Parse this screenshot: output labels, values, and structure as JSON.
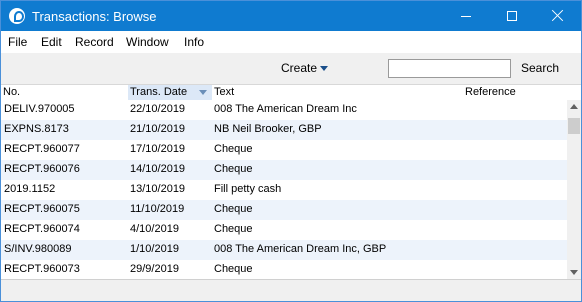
{
  "window": {
    "title": "Transactions: Browse",
    "icon": "hansaworld-icon"
  },
  "menu": [
    "File",
    "Edit",
    "Record",
    "Window",
    "Info"
  ],
  "toolbar": {
    "create_label": "Create",
    "search_value": "",
    "search_label": "Search"
  },
  "columns": {
    "no": "No.",
    "date": "Trans. Date",
    "text": "Text",
    "reference": "Reference"
  },
  "rows": [
    {
      "no": "DELIV.970005",
      "date": "22/10/2019",
      "text": "008 The American Dream Inc",
      "reference": ""
    },
    {
      "no": "EXPNS.8173",
      "date": "21/10/2019",
      "text": "NB Neil Brooker, GBP",
      "reference": ""
    },
    {
      "no": "RECPT.960077",
      "date": "17/10/2019",
      "text": "Cheque",
      "reference": ""
    },
    {
      "no": "RECPT.960076",
      "date": "14/10/2019",
      "text": "Cheque",
      "reference": ""
    },
    {
      "no": "2019.1152",
      "date": "13/10/2019",
      "text": "Fill petty cash",
      "reference": ""
    },
    {
      "no": "RECPT.960075",
      "date": "11/10/2019",
      "text": "Cheque",
      "reference": ""
    },
    {
      "no": "RECPT.960074",
      "date": "4/10/2019",
      "text": "Cheque",
      "reference": ""
    },
    {
      "no": "S/INV.980089",
      "date": "1/10/2019",
      "text": "008 The American Dream Inc, GBP",
      "reference": ""
    },
    {
      "no": "RECPT.960073",
      "date": "29/9/2019",
      "text": "Cheque",
      "reference": ""
    }
  ],
  "colors": {
    "titlebar": "#0f7bd0",
    "sorted_header": "#dce8f7",
    "alt_row": "#edf3fb"
  }
}
